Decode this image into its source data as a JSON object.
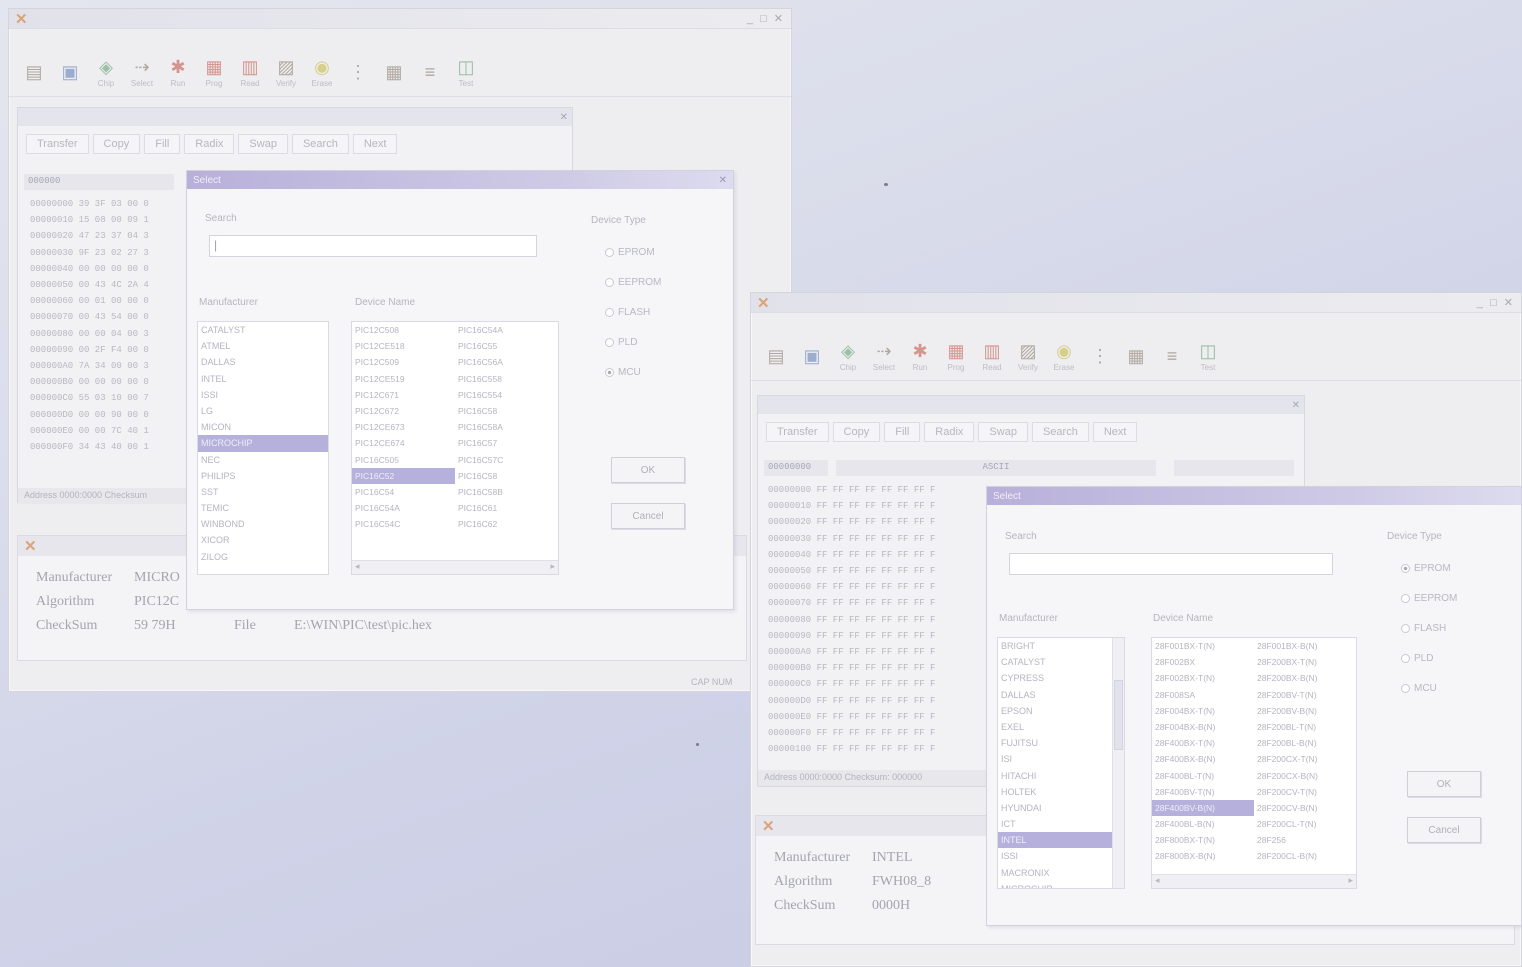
{
  "icons": {
    "app_logo": "programmer-logo-icon"
  },
  "toolbar_tools": [
    {
      "icon": "open-folder-icon",
      "label": "",
      "tone": ""
    },
    {
      "icon": "save-disk-icon",
      "label": "",
      "tone": "t-blu"
    },
    {
      "icon": "chip-icon",
      "label": "Chip",
      "tone": "t-grn"
    },
    {
      "icon": "select-icon",
      "label": "Select",
      "tone": ""
    },
    {
      "icon": "run-icon",
      "label": "Run",
      "tone": "t-red"
    },
    {
      "icon": "program-icon",
      "label": "Prog",
      "tone": "t-red"
    },
    {
      "icon": "read-icon",
      "label": "Read",
      "tone": "t-red"
    },
    {
      "icon": "verify-icon",
      "label": "Verify",
      "tone": ""
    },
    {
      "icon": "bulb-icon",
      "label": "Erase",
      "tone": "t-yel"
    },
    {
      "icon": "config-icon",
      "label": "",
      "tone": ""
    },
    {
      "icon": "buffer-icon",
      "label": "",
      "tone": ""
    },
    {
      "icon": "list-icon",
      "label": "",
      "tone": ""
    },
    {
      "icon": "test-icon",
      "label": "Test",
      "tone": "t-grn"
    }
  ],
  "buffer_tabs": [
    "Transfer",
    "Copy",
    "Fill",
    "Radix",
    "Swap",
    "Search",
    "Next"
  ],
  "window1": {
    "status_bar": "Address 0000:0000   Checksum",
    "status_right": "CAP NUM",
    "hex_rows": [
      "00000000  39 3F 03 00 0",
      "00000010  15 08 00 09 1",
      "00000020  47 23 37 04 3",
      "00000030  9F 23 02 27 3",
      "00000040  00 00 00 00 0",
      "00000050  00 43 4C 2A 4",
      "00000060  00 01 00 00 0",
      "00000070  00 43 54 00 0",
      "00000080  00 00 04 00 3",
      "00000090  00 2F F4 00 0",
      "000000A0  7A 34 00 00 3",
      "000000B0  00 00 00 00 0",
      "000000C0  55 03 10 00 7",
      "000000D0  00 00 90 00 0",
      "000000E0  00 00 7C 40 1",
      "000000F0  34 43 40 00 1"
    ],
    "info": {
      "manufacturer_label": "Manufacturer",
      "manufacturer_value": "MICRO",
      "algorithm_label": "Algorithm",
      "algorithm_value": "PIC12C",
      "checksum_label": "CheckSum",
      "checksum_value": "59 79H",
      "file_label": "File",
      "file_value": "E:\\WIN\\PIC\\test\\pic.hex"
    },
    "dialog": {
      "title": "Select",
      "search_label": "Search",
      "search_value": "|",
      "manufacturer_label": "Manufacturer",
      "device_label": "Device Name",
      "device_type_label": "Device Type",
      "manufacturers": [
        "CATALYST",
        "ATMEL",
        "DALLAS",
        "INTEL",
        "ISSI",
        "LG",
        "MICON",
        "MICROCHIP",
        "NEC",
        "PHILIPS",
        "SST",
        "TEMIC",
        "WINBOND",
        "XICOR",
        "ZILOG"
      ],
      "selected_manufacturer": 7,
      "devices": [
        "PIC12C508",
        "PIC16C54A",
        "PIC12CE518",
        "PIC16C55",
        "PIC12C509",
        "PIC16C56A",
        "PIC12CE519",
        "PIC16C558",
        "PIC12C671",
        "PIC16C554",
        "PIC12C672",
        "PIC16C58",
        "PIC12CE673",
        "PIC16C58A",
        "PIC12CE674",
        "PIC16C57",
        "PIC16C505",
        "PIC16C57C",
        "PIC16C52",
        "PIC16C58",
        "PIC16C54",
        "PIC16C58B",
        "PIC16C54A",
        "PIC16C61",
        "PIC16C54C",
        "PIC16C62"
      ],
      "selected_device": 18,
      "device_types": [
        {
          "label": "EPROM",
          "on": false
        },
        {
          "label": "EEPROM",
          "on": false
        },
        {
          "label": "FLASH",
          "on": false
        },
        {
          "label": "PLD",
          "on": false
        },
        {
          "label": "MCU",
          "on": true
        }
      ],
      "ok_label": "OK",
      "cancel_label": "Cancel"
    }
  },
  "window2": {
    "hex_head_left": "00000000",
    "hex_head_mid": "ASCII",
    "hex_head_right": "",
    "status_bar": "Address 0000:0000   Checksum: 000000",
    "status_right": "",
    "hex_rows": [
      "00000000  FF FF FF FF FF FF FF F",
      "00000010  FF FF FF FF FF FF FF F",
      "00000020  FF FF FF FF FF FF FF F",
      "00000030  FF FF FF FF FF FF FF F",
      "00000040  FF FF FF FF FF FF FF F",
      "00000050  FF FF FF FF FF FF FF F",
      "00000060  FF FF FF FF FF FF FF F",
      "00000070  FF FF FF FF FF FF FF F",
      "00000080  FF FF FF FF FF FF FF F",
      "00000090  FF FF FF FF FF FF FF F",
      "000000A0  FF FF FF FF FF FF FF F",
      "000000B0  FF FF FF FF FF FF FF F",
      "000000C0  FF FF FF FF FF FF FF F",
      "000000D0  FF FF FF FF FF FF FF F",
      "000000E0  FF FF FF FF FF FF FF F",
      "000000F0  FF FF FF FF FF FF FF F",
      "00000100  FF FF FF FF FF FF FF F"
    ],
    "info": {
      "manufacturer_label": "Manufacturer",
      "manufacturer_value": "INTEL",
      "algorithm_label": "Algorithm",
      "algorithm_value": "FWH08_8",
      "checksum_label": "CheckSum",
      "checksum_value": "0000H"
    },
    "dialog": {
      "title": "Select",
      "search_label": "Search",
      "search_value": "",
      "manufacturer_label": "Manufacturer",
      "device_label": "Device Name",
      "device_type_label": "Device Type",
      "manufacturers": [
        "BRIGHT",
        "CATALYST",
        "CYPRESS",
        "DALLAS",
        "EPSON",
        "EXEL",
        "FUJITSU",
        "ISI",
        "HITACHI",
        "HOLTEK",
        "HYUNDAI",
        "ICT",
        "INTEL",
        "ISSI",
        "MACRONIX",
        "MICROCHIP"
      ],
      "selected_manufacturer": 12,
      "devices": [
        "28F001BX-T(N)",
        "28F001BX-B(N)",
        "28F002BX",
        "28F200BX-T(N)",
        "28F002BX-T(N)",
        "28F200BX-B(N)",
        "28F008SA",
        "28F200BV-T(N)",
        "28F004BX-T(N)",
        "28F200BV-B(N)",
        "28F004BX-B(N)",
        "28F200BL-T(N)",
        "28F400BX-T(N)",
        "28F200BL-B(N)",
        "28F400BX-B(N)",
        "28F200CX-T(N)",
        "28F400BL-T(N)",
        "28F200CX-B(N)",
        "28F400BV-T(N)",
        "28F200CV-T(N)",
        "28F400BV-B(N)",
        "28F200CV-B(N)",
        "28F400BL-B(N)",
        "28F200CL-T(N)",
        "28F800BX-T(N)",
        "28F256",
        "28F800BX-B(N)",
        "28F200CL-B(N)"
      ],
      "selected_device": 20,
      "device_types": [
        {
          "label": "EPROM",
          "on": true
        },
        {
          "label": "EEPROM",
          "on": false
        },
        {
          "label": "FLASH",
          "on": false
        },
        {
          "label": "PLD",
          "on": false
        },
        {
          "label": "MCU",
          "on": false
        }
      ],
      "ok_label": "OK",
      "cancel_label": "Cancel"
    }
  }
}
